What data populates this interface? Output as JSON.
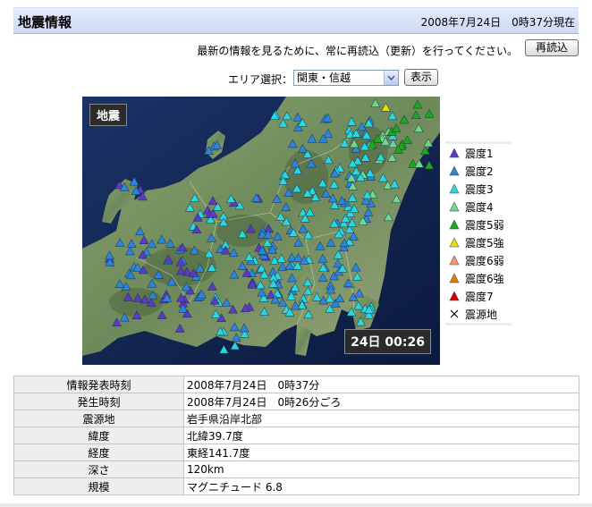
{
  "header": {
    "title": "地震情報",
    "timestamp": "2008年7月24日　0時37分現在"
  },
  "reload": {
    "message": "最新の情報を見るために、常に再読込（更新）を行ってください。",
    "button_label": "再読込"
  },
  "area": {
    "label": "エリア選択：",
    "selected": "関東・信越",
    "button_label": "表示"
  },
  "map": {
    "badge": "地震",
    "time_label": "24日 00:26"
  },
  "legend": {
    "items": [
      {
        "label": "震度1",
        "color": "#5b3bc4"
      },
      {
        "label": "震度2",
        "color": "#2b86d9"
      },
      {
        "label": "震度3",
        "color": "#27d8df"
      },
      {
        "label": "震度4",
        "color": "#6fd88a"
      },
      {
        "label": "震度5弱",
        "color": "#1ca820"
      },
      {
        "label": "震度5強",
        "color": "#e8e000"
      },
      {
        "label": "震度6弱",
        "color": "#f29a6a"
      },
      {
        "label": "震度6強",
        "color": "#e67d00"
      },
      {
        "label": "震度7",
        "color": "#d60000"
      }
    ],
    "epicenter_label": "震源地"
  },
  "info_table": [
    {
      "key": "情報発表時刻",
      "value": "2008年7月24日　0時37分"
    },
    {
      "key": "発生時刻",
      "value": "2008年7月24日　0時26分ごろ"
    },
    {
      "key": "震源地",
      "value": "岩手県沿岸北部"
    },
    {
      "key": "緯度",
      "value": "北緯39.7度"
    },
    {
      "key": "経度",
      "value": "東経141.7度"
    },
    {
      "key": "深さ",
      "value": "120km"
    },
    {
      "key": "規模",
      "value": "マグニチュード 6.8"
    }
  ]
}
